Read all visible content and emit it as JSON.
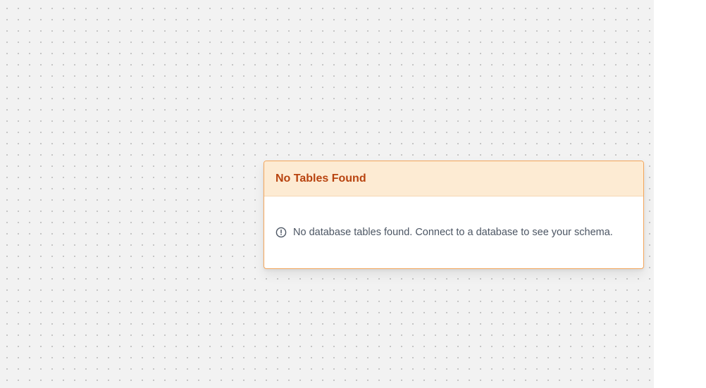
{
  "node": {
    "title": "No Tables Found",
    "message": "No database tables found. Connect to a database to see your schema.",
    "icon": "alert-circle-icon"
  },
  "colors": {
    "canvas_bg": "#f2f2f2",
    "node_border": "#f3a55a",
    "header_bg": "#fdebd3",
    "title_text": "#b8430f",
    "body_text": "#4b5563"
  }
}
